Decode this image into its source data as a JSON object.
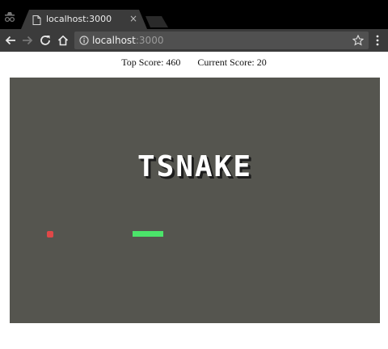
{
  "browser": {
    "tab_title": "localhost:3000",
    "tab_close": "×",
    "url_host": "localhost",
    "url_port": ":3000"
  },
  "scores": {
    "top_label": "Top Score:",
    "top_value": "460",
    "current_label": "Current Score:",
    "current_value": "20"
  },
  "game": {
    "title": "TSNAKE",
    "colors": {
      "board": "#55554f",
      "food": "#e04848",
      "snake": "#4be46a"
    },
    "food_cell": {
      "col": 12,
      "row": 48
    },
    "snake_cells": [
      {
        "col": 40,
        "row": 48
      },
      {
        "col": 41,
        "row": 48
      },
      {
        "col": 42,
        "row": 48
      },
      {
        "col": 43,
        "row": 48
      },
      {
        "col": 44,
        "row": 48
      },
      {
        "col": 45,
        "row": 48
      },
      {
        "col": 46,
        "row": 48
      },
      {
        "col": 47,
        "row": 48
      },
      {
        "col": 48,
        "row": 48
      },
      {
        "col": 49,
        "row": 48
      }
    ]
  }
}
